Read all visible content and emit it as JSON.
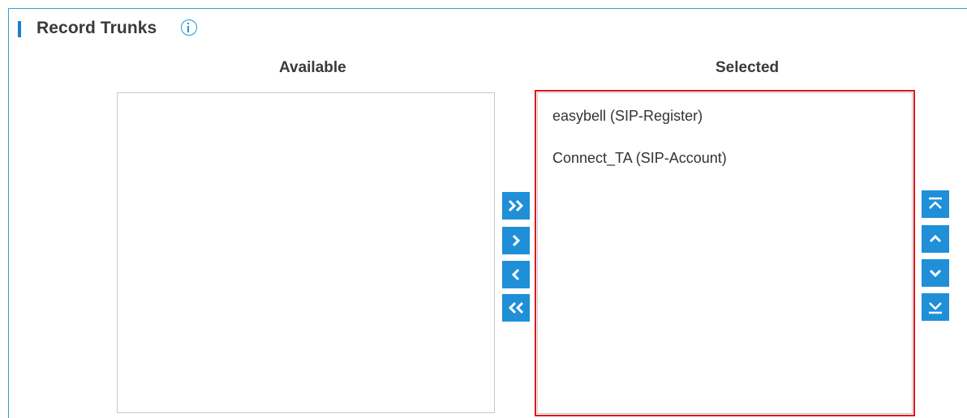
{
  "section": {
    "title": "Record Trunks",
    "info_icon": "info-circle-icon",
    "accent_color": "#1f8fd8"
  },
  "available": {
    "header": "Available",
    "items": []
  },
  "selected": {
    "header": "Selected",
    "items": [
      "easybell (SIP-Register)",
      "Connect_TA (SIP-Account)"
    ],
    "highlight_color": "#e0141c"
  },
  "transfer_buttons": [
    {
      "name": "move-all-right",
      "icon": "double-chevron-right-icon"
    },
    {
      "name": "move-right",
      "icon": "chevron-right-icon"
    },
    {
      "name": "move-left",
      "icon": "chevron-left-icon"
    },
    {
      "name": "move-all-left",
      "icon": "double-chevron-left-icon"
    }
  ],
  "order_buttons": [
    {
      "name": "move-top",
      "icon": "move-to-top-icon"
    },
    {
      "name": "move-up",
      "icon": "chevron-up-icon"
    },
    {
      "name": "move-down",
      "icon": "chevron-down-icon"
    },
    {
      "name": "move-bottom",
      "icon": "move-to-bottom-icon"
    }
  ]
}
